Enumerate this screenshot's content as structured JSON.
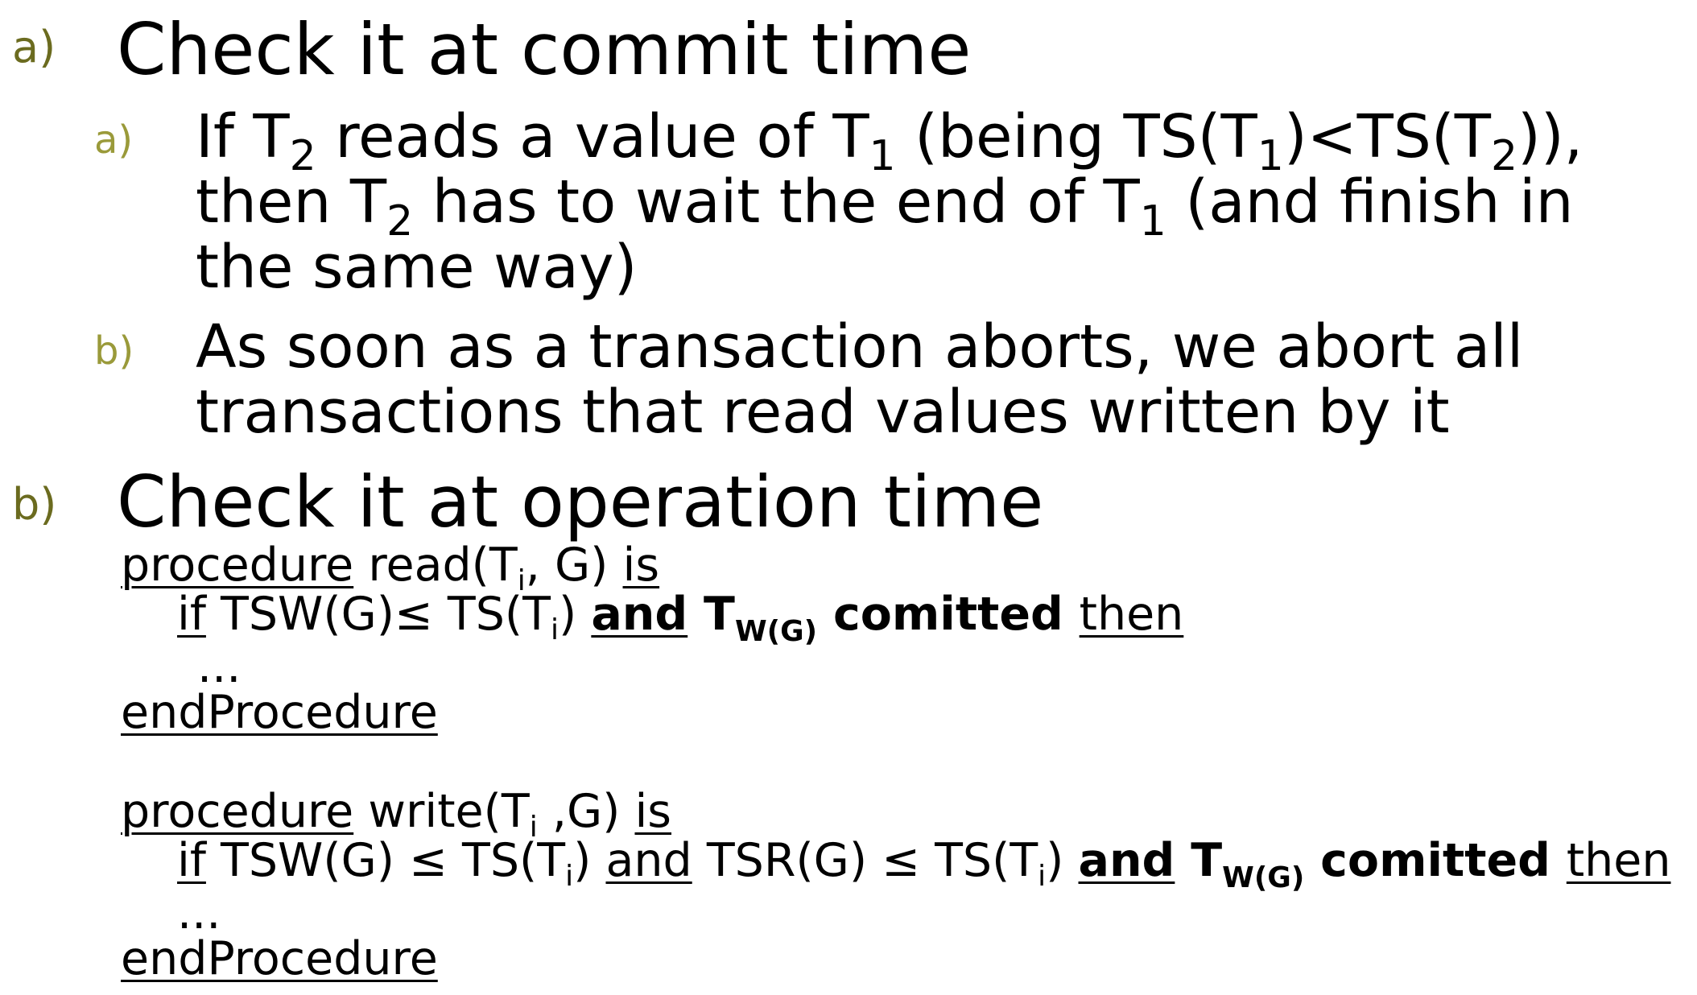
{
  "colors": {
    "level1_marker": "#6b6b1f",
    "level2_marker": "#9a9a3a",
    "text": "#000000"
  },
  "items": [
    {
      "marker": "a)",
      "heading": "Check it at commit time",
      "subitems": [
        {
          "marker": "a)",
          "line1": {
            "t1": "If T",
            "s1": "2",
            "t2": " reads a value of T",
            "s2": "1",
            "t3": " (being TS(T",
            "s3": "1",
            "t4": ")<TS(T",
            "s4": "2",
            "t5": ")),"
          },
          "line2": {
            "t1": "then T",
            "s1": "2",
            "t2": " has to wait the end of T",
            "s2": "1",
            "t3": " (and finish in"
          },
          "line3": "the same way)"
        },
        {
          "marker": "b)",
          "line1": "As soon as a transaction aborts, we abort all",
          "line2": "transactions that read values written by it"
        }
      ]
    },
    {
      "marker": "b)",
      "heading": "Check it at operation time"
    }
  ],
  "code": {
    "read_proc": {
      "kw_procedure": "procedure",
      "sig_a": " read(T",
      "sig_sub": "i",
      "sig_b": ", G) ",
      "kw_is": "is",
      "kw_if": "if",
      "cond_a": " TSW(G)≤ TS(T",
      "cond_sub": "i",
      "cond_b": ") ",
      "kw_and": "and",
      "t_space": " T",
      "t_sub": "W(G)",
      "committed": " comitted ",
      "kw_then": "then",
      "ellipsis": "...",
      "kw_end": "endProcedure"
    },
    "write_proc": {
      "kw_procedure": "procedure",
      "sig_a": " write(T",
      "sig_sub": "i",
      "sig_b": " ,G) ",
      "kw_is": "is",
      "kw_if": "if",
      "cond_a": " TSW(G) ≤ TS(T",
      "cond_sub": "i",
      "cond_b": ") ",
      "kw_and1": "and",
      "cond_c": " TSR(G) ≤ TS(T",
      "cond_sub2": "i",
      "cond_d": ") ",
      "kw_and2": "and",
      "t_space": " T",
      "t_sub": "W(G)",
      "committed": " comitted ",
      "kw_then": "then",
      "ellipsis": "...",
      "kw_end": "endProcedure"
    }
  }
}
